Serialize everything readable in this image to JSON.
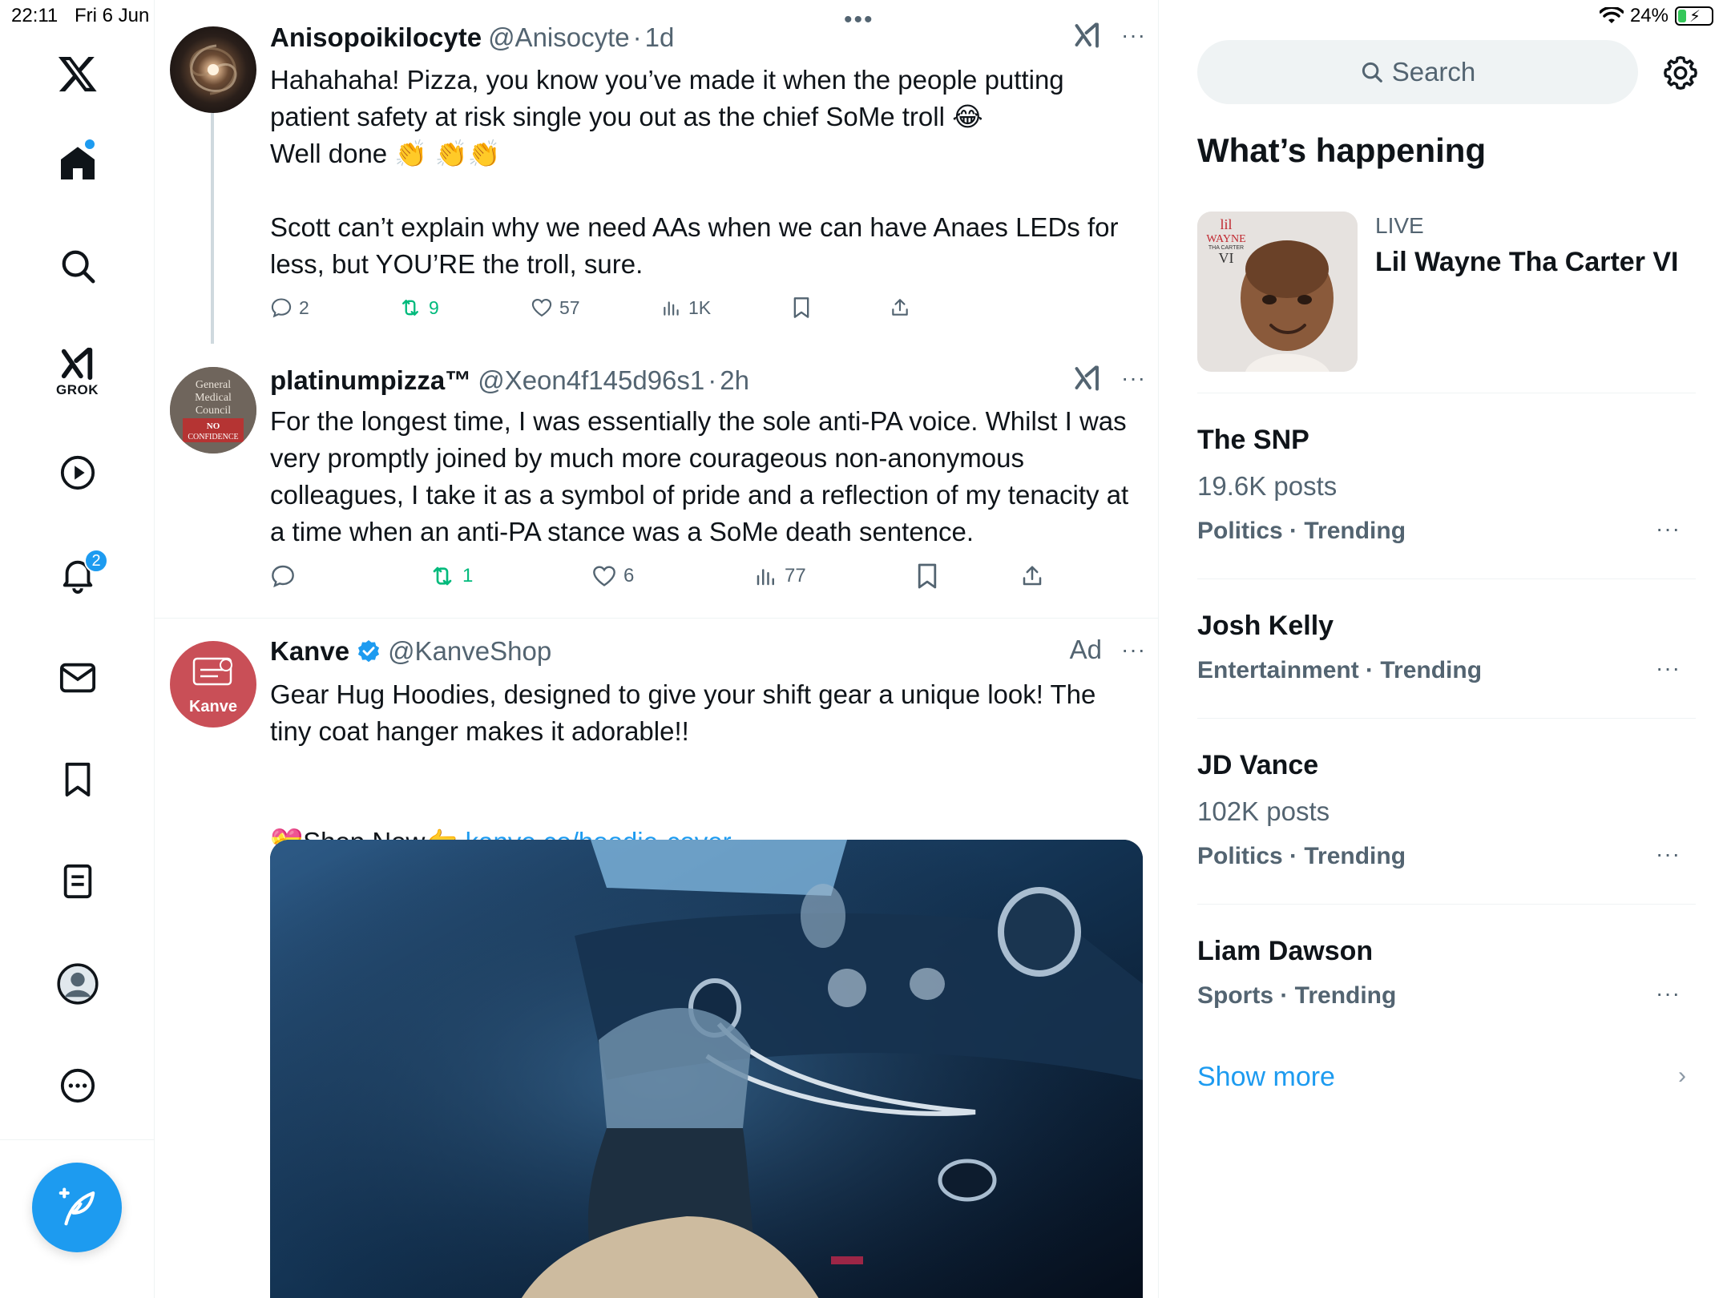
{
  "status_bar": {
    "time": "22:11",
    "date": "Fri 6 Jun",
    "battery": "24%",
    "battery_level": 0.24
  },
  "nav": {
    "grok_label": "GROK",
    "notifications_count": "2"
  },
  "timeline": {
    "tweets": [
      {
        "name": "Anisopoikilocyte",
        "handle": "@Anisocyte",
        "sep": "·",
        "time": "1d",
        "text": "Hahahaha! Pizza, you know you’ve made it when the people putting patient safety at risk single you out as the chief SoMe troll 😂\nWell done 👏 👏👏\n\nScott can’t explain why we need AAs when we can have Anaes LEDs for less, but YOU’RE the troll, sure.",
        "replies": "2",
        "reposts": "9",
        "likes": "57",
        "views": "1K"
      },
      {
        "name": "platinumpizza™",
        "handle": "@Xeon4f145d96s1",
        "sep": "·",
        "time": "2h",
        "text": "For the longest time, I was essentially the sole anti-PA voice. Whilst I was very promptly joined by much more courageous non-anonymous colleagues, I take it as a symbol of pride and a reflection of my tenacity at a time when an anti-PA stance was a SoMe death sentence.",
        "avatar_text": [
          "General",
          "Medical",
          "Council",
          "NO",
          "CONFIDENCE"
        ],
        "replies": "",
        "reposts": "1",
        "likes": "6",
        "views": "77"
      },
      {
        "name": "Kanve",
        "handle": "@KanveShop",
        "ad_label": "Ad",
        "avatar_text": "Kanve",
        "text": "Gear Hug Hoodies, designed to give your shift gear a unique look!  The tiny coat hanger makes it adorable!!",
        "shop_prefix": "💝Shop Now👉 ",
        "link": "kanve.co/hoodie-cover"
      }
    ]
  },
  "sidebar": {
    "search_placeholder": "Search",
    "section_title": "What’s happening",
    "live": {
      "label": "LIVE",
      "title": "Lil Wayne Tha Carter VI",
      "album_text": [
        "lil",
        "WAYNE",
        "THA CARTER",
        "VI"
      ]
    },
    "trends": [
      {
        "name": "The SNP",
        "posts": "19.6K posts",
        "meta": "Politics · Trending"
      },
      {
        "name": "Josh Kelly",
        "posts": "",
        "meta": "Entertainment · Trending"
      },
      {
        "name": "JD Vance",
        "posts": "102K posts",
        "meta": "Politics · Trending"
      },
      {
        "name": "Liam Dawson",
        "posts": "",
        "meta": "Sports · Trending"
      }
    ],
    "show_more": "Show more"
  },
  "colors": {
    "accent": "#1d9bf0",
    "repost_green": "#00ba7c",
    "secondary_text": "#536471"
  }
}
